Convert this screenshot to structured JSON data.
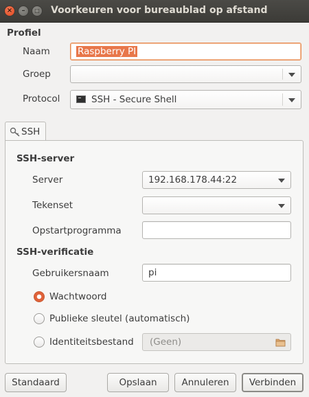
{
  "window": {
    "title": "Voorkeuren voor bureaublad op afstand"
  },
  "profile": {
    "heading": "Profiel",
    "name_label": "Naam",
    "name_value": "Raspberry PI",
    "group_label": "Groep",
    "group_value": "",
    "protocol_label": "Protocol",
    "protocol_value": "SSH - Secure Shell",
    "protocol_icon": "terminal-icon"
  },
  "tabs": [
    {
      "label": "SSH",
      "icon": "key-icon"
    }
  ],
  "ssh": {
    "server_heading": "SSH-server",
    "server_label": "Server",
    "server_value": "192.168.178.44:22",
    "charset_label": "Tekenset",
    "charset_value": "",
    "startup_label": "Opstartprogramma",
    "startup_value": "",
    "auth_heading": "SSH-verificatie",
    "username_label": "Gebruikersnaam",
    "username_value": "pi",
    "auth_options": [
      "Wachtwoord",
      "Publieke sleutel (automatisch)",
      "Identiteitsbestand"
    ],
    "auth_selected": "Wachtwoord",
    "identity_file_value": "(Geen)"
  },
  "buttons": {
    "default": "Standaard",
    "save": "Opslaan",
    "cancel": "Annuleren",
    "connect": "Verbinden"
  },
  "colors": {
    "accent": "#e8774a",
    "titlebar": "#3c3b37"
  }
}
